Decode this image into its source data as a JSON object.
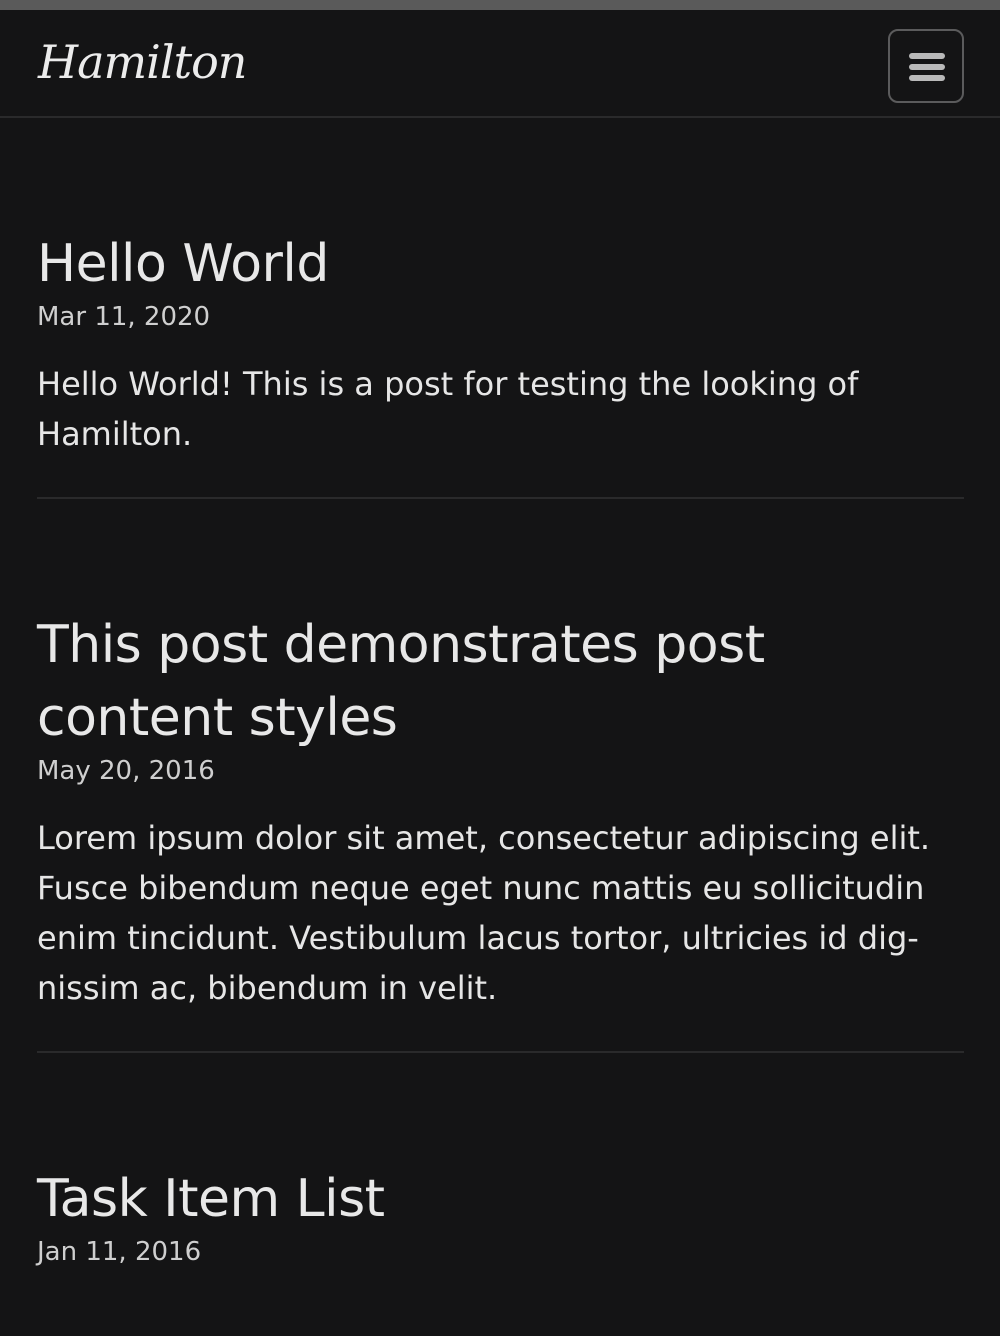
{
  "header": {
    "site_title": "Hamilton",
    "menu_icon": "hamburger-menu-icon"
  },
  "posts": [
    {
      "title": "Hello World",
      "date": "Mar 11, 2020",
      "excerpt": "Hello World! This is a post for testing the looking of Hamilton."
    },
    {
      "title": "This post demonstrates post content styles",
      "date": "May 20, 2016",
      "excerpt": "Lorem ipsum dolor sit amet, consectetur adipiscing elit. Fusce bibendum neque eget nunc mattis eu sollicitudin enim tincidunt. Vestibulum lacus tortor, ultricies id dig-nissim ac, bibendum in velit."
    },
    {
      "title": "Task Item List",
      "date": "Jan 11, 2016"
    }
  ],
  "colors": {
    "background": "#141415",
    "text": "#e6e6e6",
    "divider": "#2a2a2b",
    "menu_border": "#5b5b5c"
  }
}
